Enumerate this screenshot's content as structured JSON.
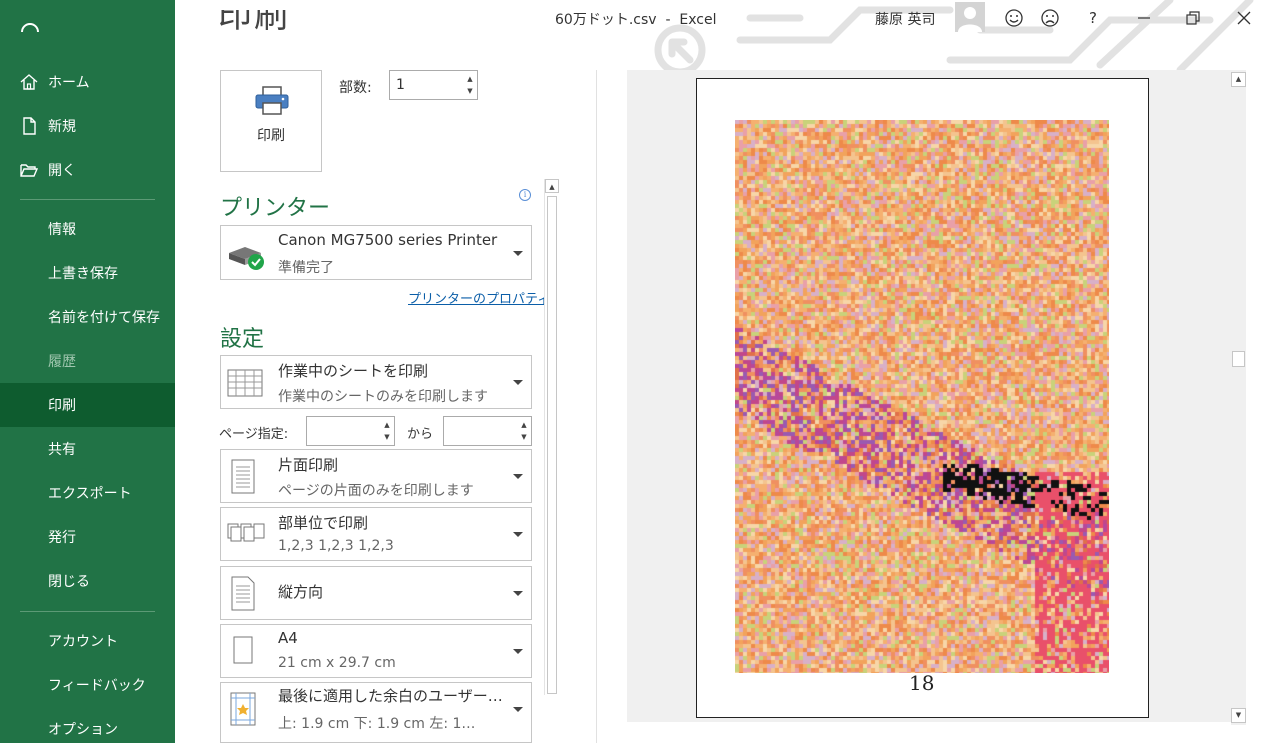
{
  "window": {
    "title": "60万ドット.csv  -  Excel",
    "user": "藤原 英司",
    "help_label": "?"
  },
  "sidebar": {
    "items": [
      {
        "label": "ホーム",
        "icon": "home-icon"
      },
      {
        "label": "新規",
        "icon": "new-doc-icon"
      },
      {
        "label": "開く",
        "icon": "folder-open-icon"
      },
      {
        "label": "情報"
      },
      {
        "label": "上書き保存"
      },
      {
        "label": "名前を付けて保存"
      },
      {
        "label": "履歴",
        "state": "disabled"
      },
      {
        "label": "印刷",
        "state": "active"
      },
      {
        "label": "共有"
      },
      {
        "label": "エクスポート"
      },
      {
        "label": "発行"
      },
      {
        "label": "閉じる"
      },
      {
        "label": "アカウント"
      },
      {
        "label": "フィードバック"
      },
      {
        "label": "オプション"
      }
    ]
  },
  "print": {
    "heading": "印刷",
    "button_label": "印刷",
    "copies_label": "部数:",
    "copies_value": "1"
  },
  "printer": {
    "section_title": "プリンター",
    "name": "Canon MG7500 series Printer",
    "status": "準備完了",
    "properties_link": "プリンターのプロパティ"
  },
  "settings": {
    "section_title": "設定",
    "what_to_print": {
      "main": "作業中のシートを印刷",
      "sub": "作業中のシートのみを印刷します"
    },
    "pages_label": "ページ指定:",
    "pages_from": "",
    "pages_to_label": "から",
    "pages_to": "",
    "sides": {
      "main": "片面印刷",
      "sub": "ページの片面のみを印刷します"
    },
    "collation": {
      "main": "部単位で印刷",
      "sub": "1,2,3    1,2,3    1,2,3"
    },
    "orientation": {
      "main": "縦方向"
    },
    "paper": {
      "main": "A4",
      "sub": "21 cm x 29.7 cm"
    },
    "margins": {
      "main": "最後に適用した余白のユーザー…",
      "sub": "上: 1.9 cm 下: 1.9 cm 左: 1…"
    }
  },
  "preview": {
    "page_number_shown": "18"
  },
  "colors": {
    "accent": "#217346",
    "active": "#0e5c2f",
    "link": "#0b5ea8"
  }
}
